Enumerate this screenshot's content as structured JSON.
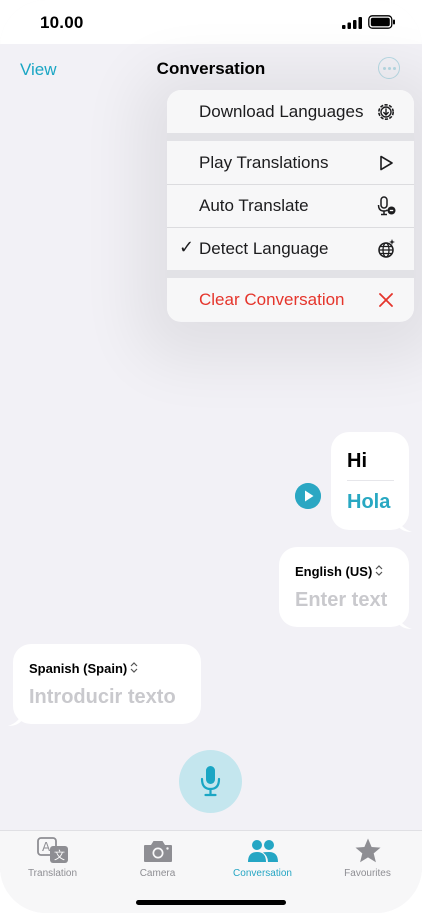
{
  "status": {
    "time": "10.00"
  },
  "nav": {
    "left_label": "View",
    "title": "Conversation"
  },
  "menu": {
    "items": [
      {
        "label": "Download Languages",
        "icon": "download-gear-icon"
      },
      {
        "label": "Play Translations",
        "icon": "play-outline-icon"
      },
      {
        "label": "Auto Translate",
        "icon": "mic-auto-icon"
      },
      {
        "label": "Detect Language",
        "icon": "globe-sparkle-icon",
        "checked": true,
        "check": "✓"
      },
      {
        "label": "Clear Conversation",
        "icon": "x-icon",
        "destructive": true
      }
    ]
  },
  "conversation": {
    "source_text": "Hi",
    "translated_text": "Hola"
  },
  "english_panel": {
    "language": "English (US)",
    "placeholder": "Enter text"
  },
  "spanish_panel": {
    "language": "Spanish (Spain)",
    "placeholder": "Introducir texto"
  },
  "tabs": [
    {
      "label": "Translation",
      "icon": "translation-icon",
      "active": false
    },
    {
      "label": "Camera",
      "icon": "camera-icon",
      "active": false
    },
    {
      "label": "Conversation",
      "icon": "people-icon",
      "active": true
    },
    {
      "label": "Favourites",
      "icon": "star-icon",
      "active": false
    }
  ],
  "colors": {
    "accent": "#1aa6c4",
    "destructive": "#e5352c",
    "background": "#f2f1f6",
    "mic_button": "#c4e6ee"
  }
}
